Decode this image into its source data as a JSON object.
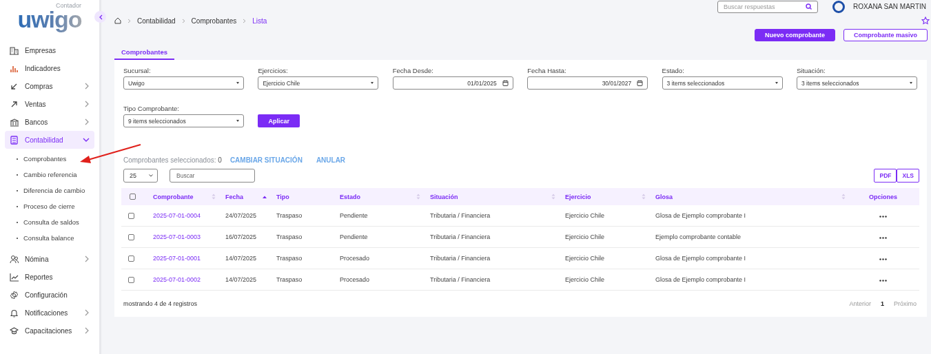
{
  "header": {
    "search_placeholder": "Buscar respuestas",
    "user_name": "ROXANA SAN MARTIN"
  },
  "sidebar": {
    "logo": "uwigo",
    "logo_subtitle": "Contador",
    "items": [
      {
        "label": "Empresas",
        "kind": "link",
        "selected": false
      },
      {
        "label": "Indicadores",
        "kind": "link",
        "selected": false
      },
      {
        "label": "Compras",
        "kind": "group",
        "expanded": false,
        "selected": false
      },
      {
        "label": "Ventas",
        "kind": "group",
        "expanded": false,
        "selected": false
      },
      {
        "label": "Bancos",
        "kind": "group",
        "expanded": false,
        "selected": false
      },
      {
        "label": "Contabilidad",
        "kind": "group",
        "expanded": true,
        "selected": true,
        "children": [
          {
            "label": "Comprobantes"
          },
          {
            "label": "Cambio referencia"
          },
          {
            "label": "Diferencia de cambio"
          },
          {
            "label": "Proceso de cierre"
          },
          {
            "label": "Consulta de saldos"
          },
          {
            "label": "Consulta balance"
          }
        ]
      },
      {
        "label": "Nómina",
        "kind": "group",
        "expanded": false,
        "selected": false
      },
      {
        "label": "Reportes",
        "kind": "link",
        "selected": false
      },
      {
        "label": "Configuración",
        "kind": "link",
        "selected": false
      },
      {
        "label": "Notificaciones",
        "kind": "group",
        "expanded": false,
        "selected": false
      },
      {
        "label": "Capacitaciones",
        "kind": "group",
        "expanded": false,
        "selected": false
      }
    ]
  },
  "breadcrumb": [
    "Contabilidad",
    "Comprobantes",
    "Lista"
  ],
  "actions": [
    {
      "label": "Nuevo comprobante",
      "kind": "primary"
    },
    {
      "label": "Comprobante masivo",
      "kind": "outline"
    }
  ],
  "tabs": [
    {
      "label": "Comprobantes",
      "selected": true
    }
  ],
  "filters": [
    {
      "label": "Sucursal:",
      "kind": "select",
      "value": "Uwigo"
    },
    {
      "label": "Ejercicios:",
      "kind": "select",
      "value": "Ejercicio Chile"
    },
    {
      "label": "Fecha Desde:",
      "kind": "date",
      "value": "01/01/2025"
    },
    {
      "label": "Fecha Hasta:",
      "kind": "date",
      "value": "30/01/2027"
    },
    {
      "label": "Estado:",
      "kind": "select",
      "value": "3 items seleccionados"
    },
    {
      "label": "Situación:",
      "kind": "select",
      "value": "3 items seleccionados"
    },
    {
      "label": "Tipo Comprobante:",
      "kind": "select",
      "value": "9 items seleccionados"
    }
  ],
  "apply_button": "Aplicar",
  "selection": {
    "label": "Comprobantes seleccionados:",
    "count": "0",
    "actions": [
      "CAMBIAR SITUACIÓN",
      "ANULAR"
    ]
  },
  "table": {
    "page_size": "25",
    "search_placeholder": "Buscar",
    "exports": [
      "PDF",
      "XLS"
    ],
    "select_all_checked": false,
    "columns": [
      {
        "label": "Comprobante",
        "sortable": true,
        "sorted": false
      },
      {
        "label": "Fecha",
        "sortable": true,
        "sorted": true
      },
      {
        "label": "Tipo",
        "sortable": false,
        "sorted": false
      },
      {
        "label": "Estado",
        "sortable": true,
        "sorted": false
      },
      {
        "label": "Situación",
        "sortable": true,
        "sorted": false
      },
      {
        "label": "Ejercicio",
        "sortable": true,
        "sorted": false
      },
      {
        "label": "Glosa",
        "sortable": true,
        "sorted": false
      },
      {
        "label": "Opciones",
        "sortable": false,
        "sorted": false
      }
    ],
    "rows": [
      {
        "checked": false,
        "cells": [
          "2025-07-01-0004",
          "24/07/2025",
          "Traspaso",
          "Pendiente",
          "Tributaria / Financiera",
          "Ejercicio Chile",
          "Glosa de Ejemplo comprobante I"
        ]
      },
      {
        "checked": false,
        "cells": [
          "2025-07-01-0003",
          "16/07/2025",
          "Traspaso",
          "Pendiente",
          "Tributaria / Financiera",
          "Ejercicio Chile",
          "Ejemplo comprobante contable"
        ]
      },
      {
        "checked": false,
        "cells": [
          "2025-07-01-0001",
          "14/07/2025",
          "Traspaso",
          "Procesado",
          "Tributaria / Financiera",
          "Ejercicio Chile",
          "Glosa de Ejemplo comprobante I"
        ]
      },
      {
        "checked": false,
        "cells": [
          "2025-07-01-0002",
          "14/07/2025",
          "Traspaso",
          "Procesado",
          "Tributaria / Financiera",
          "Ejercicio Chile",
          "Glosa de Ejemplo comprobante I"
        ]
      }
    ]
  },
  "footer": {
    "summary": "mostrando 4 de 4 registros",
    "previous": "Anterior",
    "pages": [
      {
        "label": "1",
        "selected": true
      }
    ],
    "next": "Próximo"
  }
}
